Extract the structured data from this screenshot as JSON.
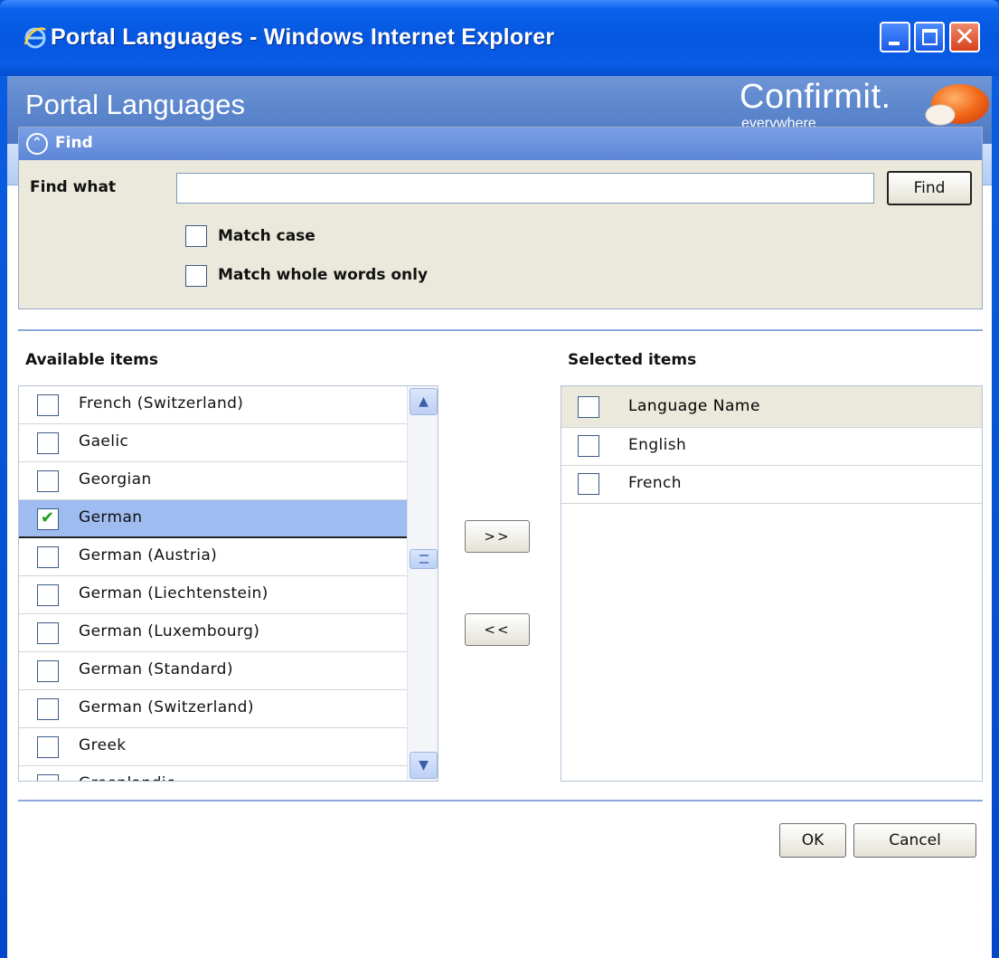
{
  "window": {
    "title": "Portal Languages - Windows Internet Explorer"
  },
  "header": {
    "title": "Portal Languages",
    "brand_name": "Confirmit.",
    "brand_tagline": "everywhere"
  },
  "find": {
    "section_label": "Find",
    "find_what_label": "Find what",
    "find_input_value": "",
    "find_button_label": "Find",
    "match_case_label": "Match case",
    "match_case_checked": false,
    "match_whole_label": "Match whole words only",
    "match_whole_checked": false
  },
  "available": {
    "label": "Available items",
    "items": [
      {
        "label": "French (Switzerland)",
        "checked": false
      },
      {
        "label": "Gaelic",
        "checked": false
      },
      {
        "label": "Georgian",
        "checked": false
      },
      {
        "label": "German",
        "checked": true
      },
      {
        "label": "German (Austria)",
        "checked": false
      },
      {
        "label": "German (Liechtenstein)",
        "checked": false
      },
      {
        "label": "German (Luxembourg)",
        "checked": false
      },
      {
        "label": "German (Standard)",
        "checked": false
      },
      {
        "label": "German (Switzerland)",
        "checked": false
      },
      {
        "label": "Greek",
        "checked": false
      },
      {
        "label": "Greenlandic",
        "checked": false
      }
    ]
  },
  "transfer": {
    "add_label": ">>",
    "remove_label": "<<"
  },
  "selected": {
    "label": "Selected items",
    "column_header": "Language Name",
    "items": [
      {
        "label": "English",
        "checked": false
      },
      {
        "label": "French",
        "checked": false
      }
    ]
  },
  "footer": {
    "ok_label": "OK",
    "cancel_label": "Cancel"
  },
  "colors": {
    "titlebar": "#0457e0",
    "header_band": "#5c86cc",
    "panel_bg": "#ebe9dc",
    "selected_row": "#9ebcf0",
    "close_button": "#d6411c"
  }
}
